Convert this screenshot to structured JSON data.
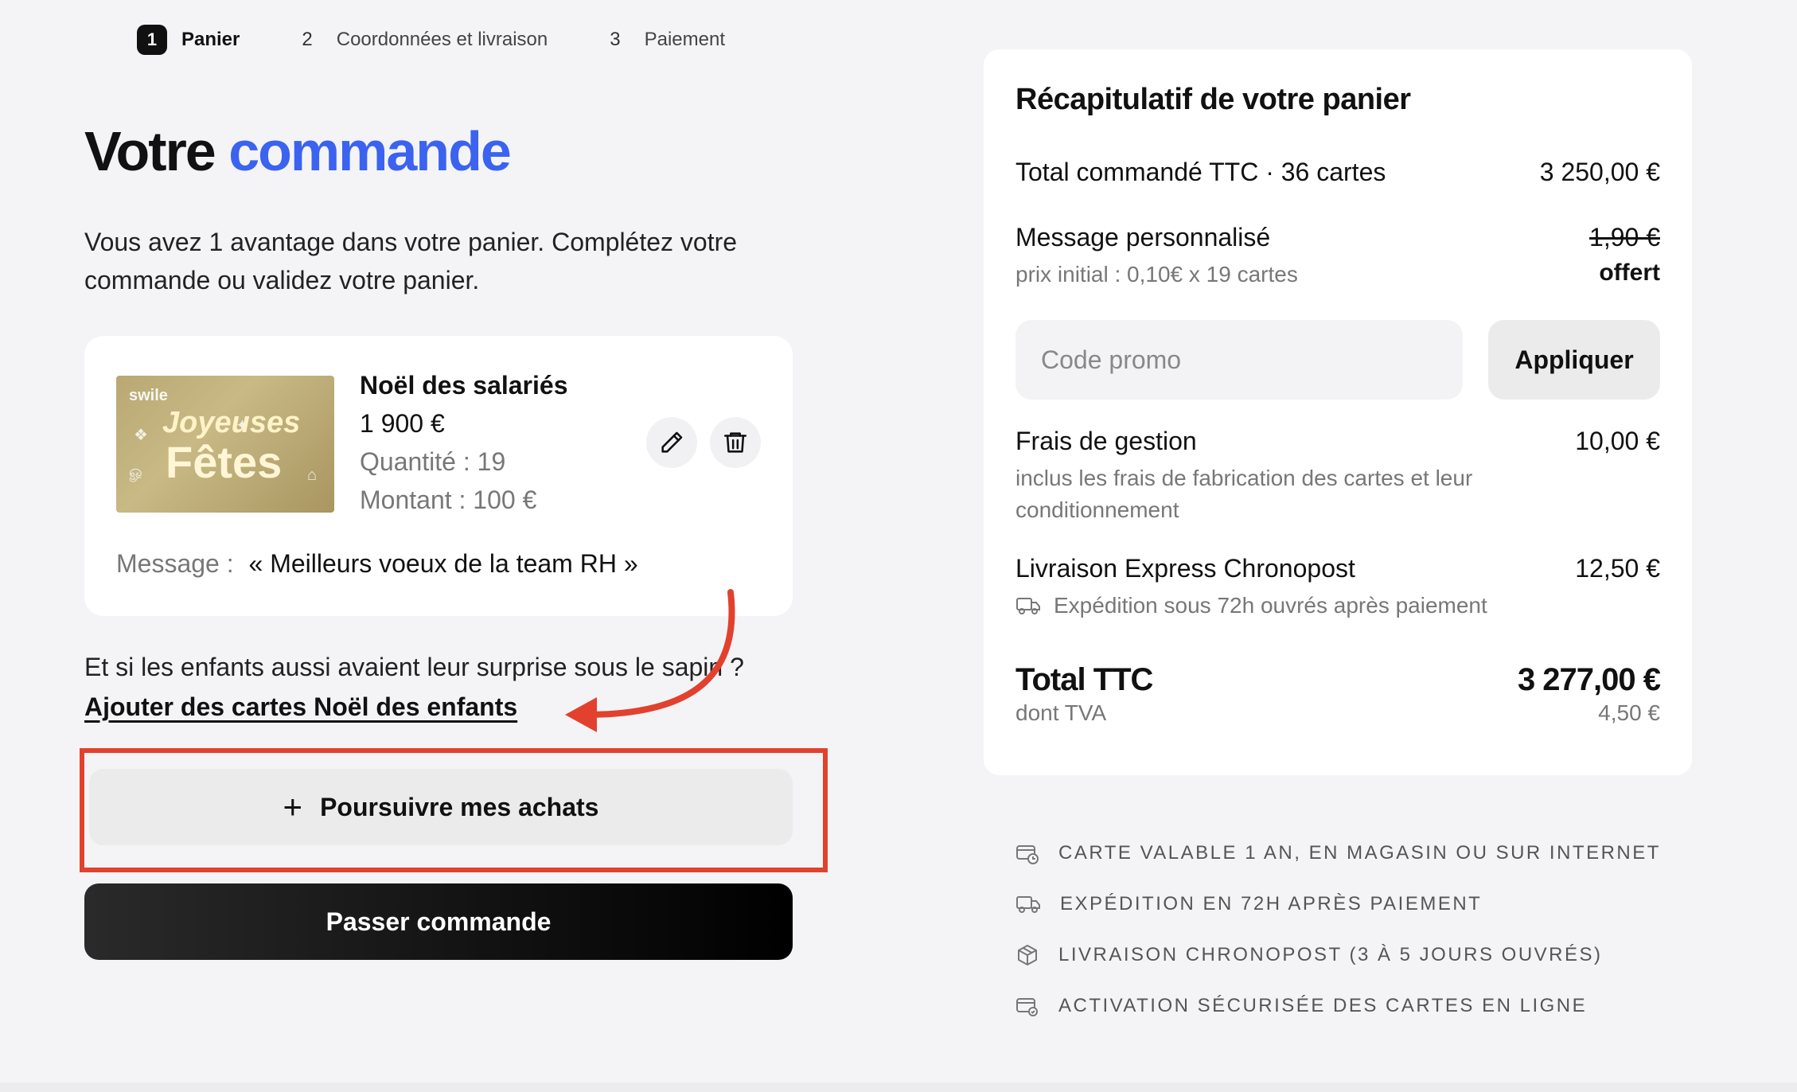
{
  "stepper": [
    {
      "num": "1",
      "label": "Panier"
    },
    {
      "num": "2",
      "label": "Coordonnées et livraison"
    },
    {
      "num": "3",
      "label": "Paiement"
    }
  ],
  "page": {
    "title_main": "Votre",
    "title_accent": "commande",
    "intro": "Vous avez 1 avantage dans votre panier. Complétez votre commande ou validez votre panier."
  },
  "product": {
    "card_brand": "swile",
    "card_line1": "Joyeuses",
    "card_line2": "Fêtes",
    "name": "Noël des salariés",
    "price": "1 900 €",
    "quantity": "Quantité : 19",
    "amount": "Montant :  100 €",
    "message_label": "Message :",
    "message_text": "« Meilleurs voeux de la team RH »"
  },
  "upsell": {
    "question": "Et si les enfants aussi avaient leur surprise sous le sapin ?",
    "link": "Ajouter des cartes Noël des enfants"
  },
  "actions": {
    "continue_label": "Poursuivre mes achats",
    "checkout_label": "Passer commande"
  },
  "summary": {
    "title": "Récapitulatif de votre panier",
    "total_ordered_label": "Total commandé TTC · 36 cartes",
    "total_ordered_value": "3 250,00 €",
    "custom_msg_label": "Message personnalisé",
    "custom_msg_sub": "prix initial : 0,10€ x 19 cartes",
    "custom_msg_old": "1,90 €",
    "custom_msg_new": "offert",
    "promo_placeholder": "Code promo",
    "apply_label": "Appliquer",
    "fees_label": "Frais de gestion",
    "fees_value": "10,00 €",
    "fees_sub": "inclus les frais de fabrication des cartes et leur conditionnement",
    "delivery_label": "Livraison Express Chronopost",
    "delivery_value": "12,50 €",
    "delivery_sub": "Expédition sous 72h ouvrés après paiement",
    "total_label": "Total TTC",
    "total_value": "3 277,00 €",
    "tva_label": "dont TVA",
    "tva_value": "4,50 €"
  },
  "features": [
    {
      "icon": "card-calendar-icon",
      "label": "CARTE VALABLE 1 AN, EN MAGASIN OU SUR INTERNET"
    },
    {
      "icon": "truck-icon",
      "label": "EXPÉDITION EN 72H APRÈS PAIEMENT"
    },
    {
      "icon": "package-icon",
      "label": "LIVRAISON CHRONOPOST (3 À 5 JOURS OUVRÉS)"
    },
    {
      "icon": "card-secure-icon",
      "label": "ACTIVATION SÉCURISÉE DES CARTES EN LIGNE"
    }
  ],
  "colors": {
    "accent": "#3b63f0",
    "highlight": "#e2412e",
    "background": "#f4f4f7"
  }
}
